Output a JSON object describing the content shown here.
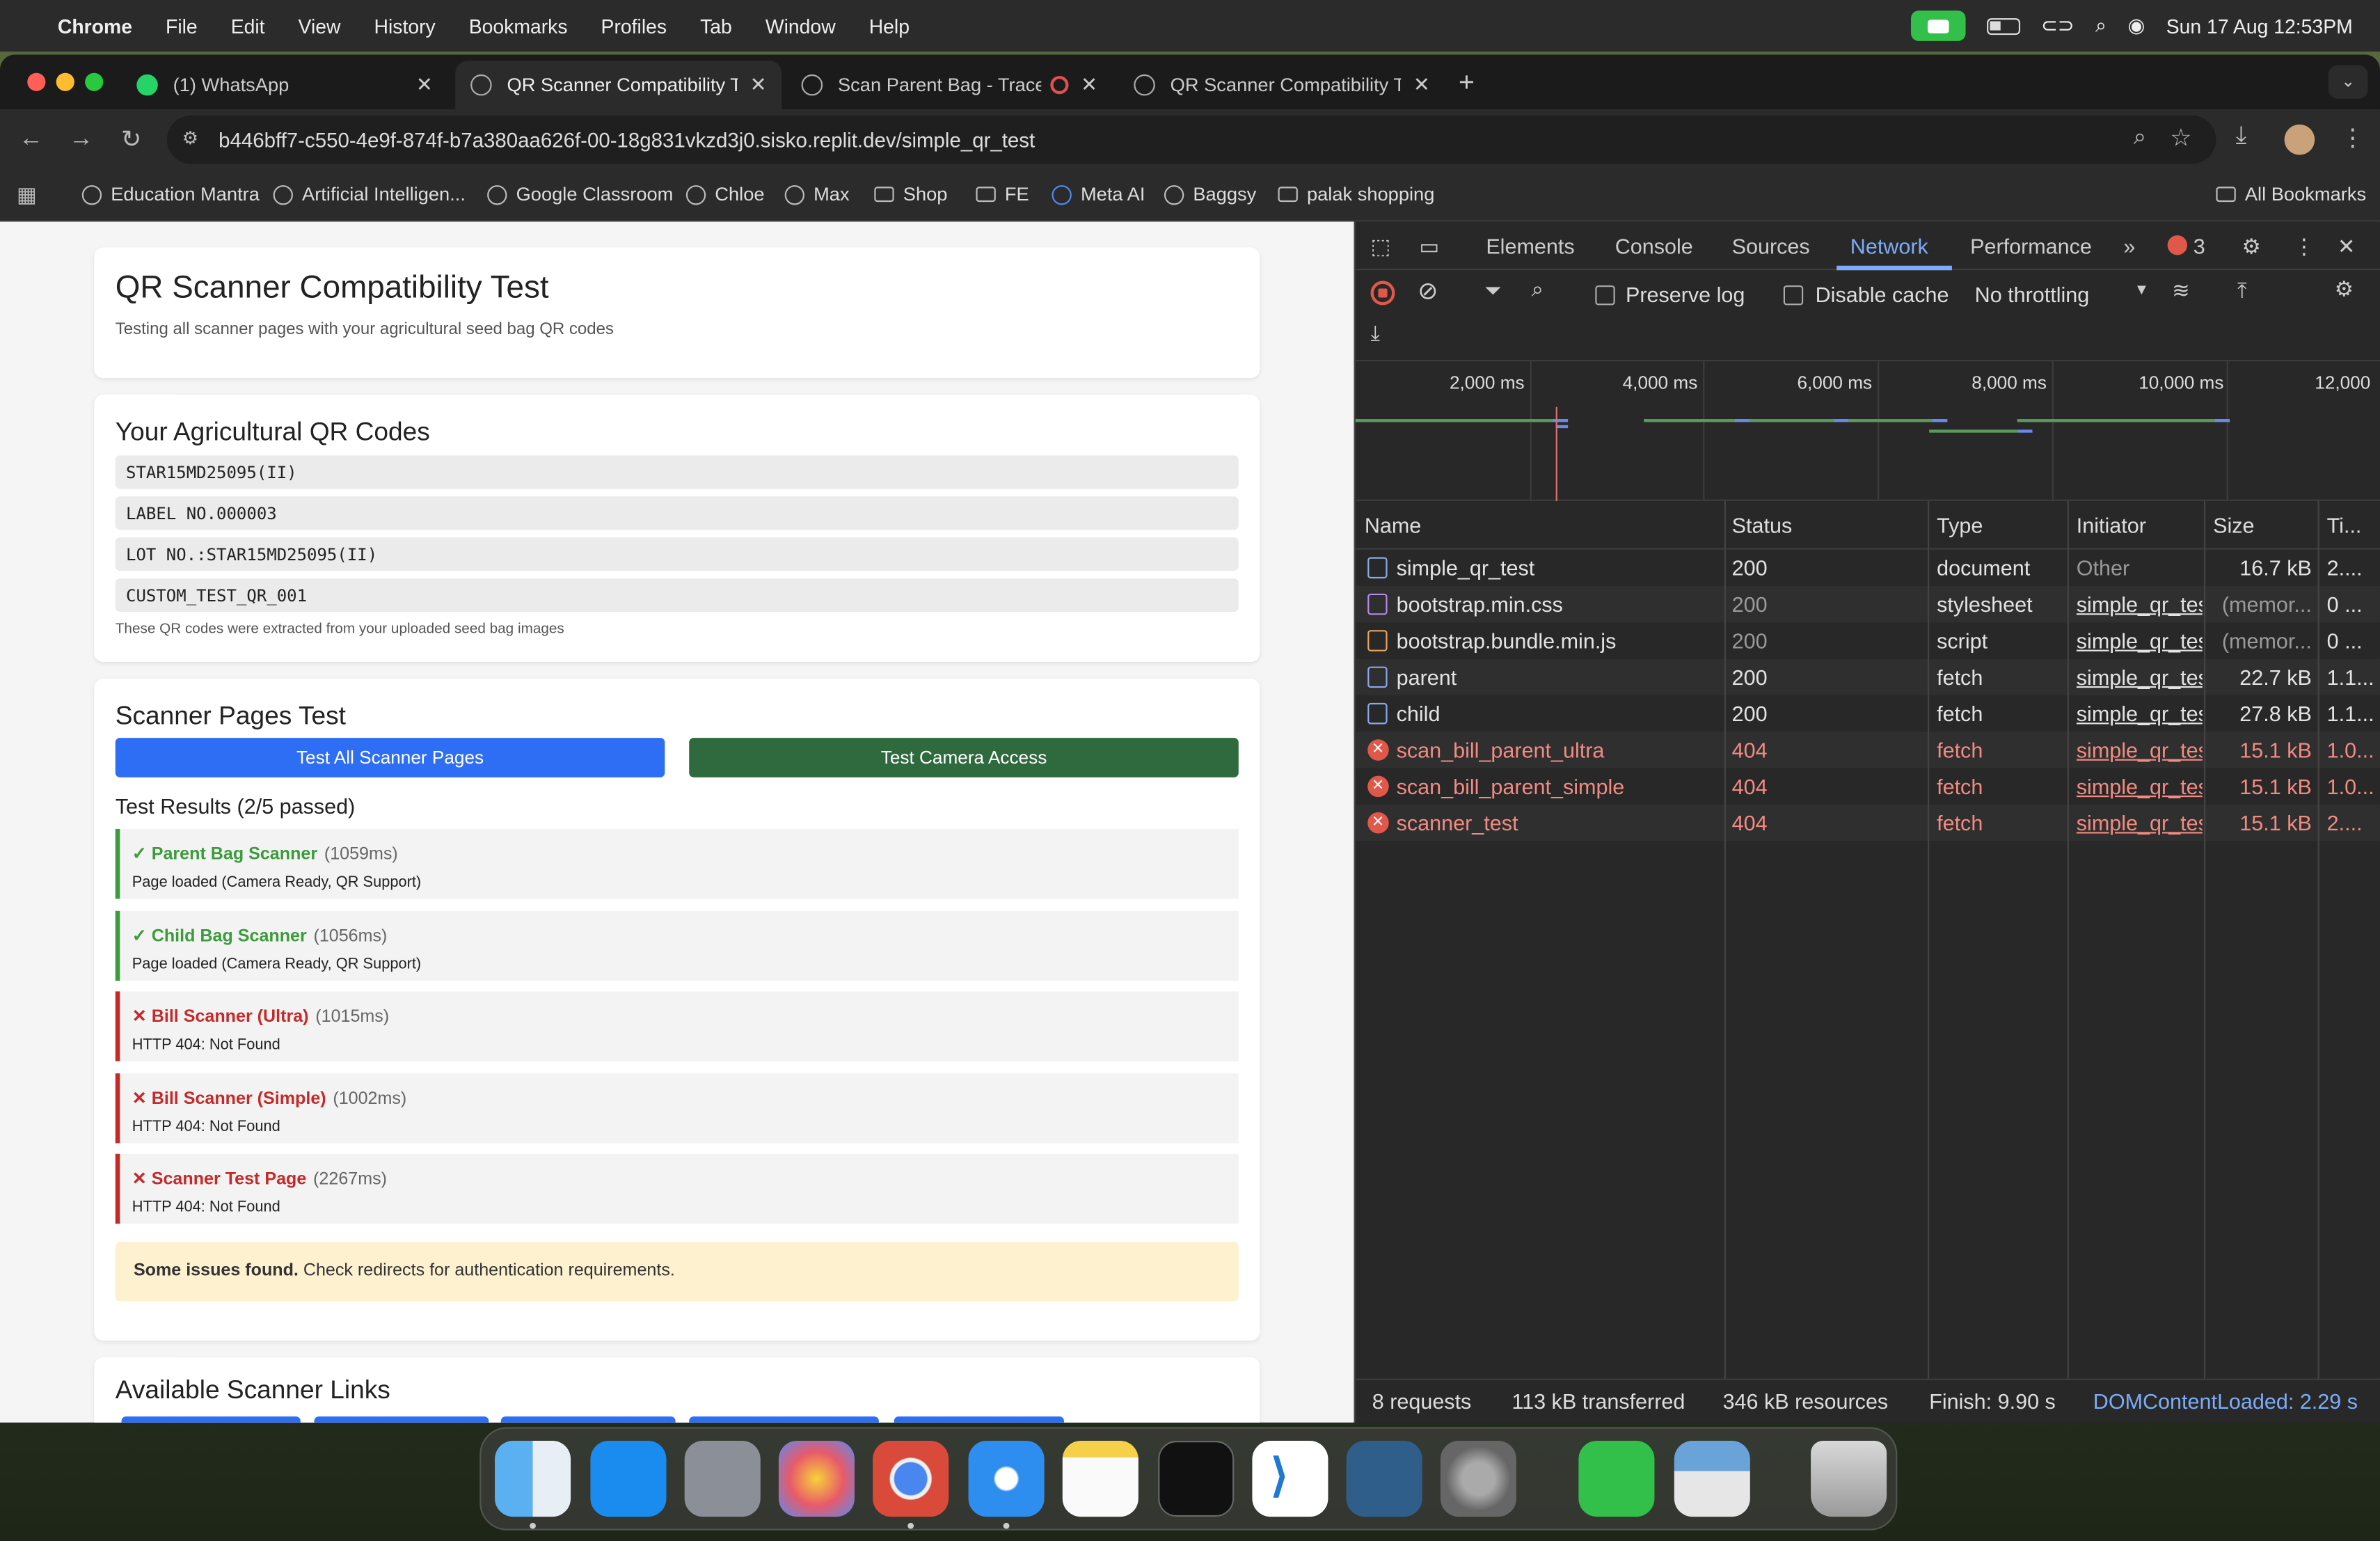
{
  "menubar": {
    "app": "Chrome",
    "menus": [
      "File",
      "Edit",
      "View",
      "History",
      "Bookmarks",
      "Profiles",
      "Tab",
      "Window",
      "Help"
    ],
    "datetime": "Sun 17 Aug  12:53PM"
  },
  "tabs": [
    {
      "title": "(1) WhatsApp"
    },
    {
      "title": "QR Scanner Compatibility Test"
    },
    {
      "title": "Scan Parent Bag - TraceTrack"
    },
    {
      "title": "QR Scanner Compatibility Test"
    }
  ],
  "url": "b446bff7-c550-4e9f-874f-b7a380aa626f-00-18g831vkzd3j0.sisko.replit.dev/simple_qr_test",
  "bookmarks": [
    {
      "label": "Education Mantra",
      "kind": "site"
    },
    {
      "label": "Artificial Intelligen...",
      "kind": "site"
    },
    {
      "label": "Google Classroom",
      "kind": "site"
    },
    {
      "label": "Chloe",
      "kind": "site"
    },
    {
      "label": "Max",
      "kind": "site"
    },
    {
      "label": "Shop",
      "kind": "folder"
    },
    {
      "label": "FE",
      "kind": "folder"
    },
    {
      "label": "Meta AI",
      "kind": "site"
    },
    {
      "label": "Baggsy",
      "kind": "site"
    },
    {
      "label": "palak shopping",
      "kind": "folder"
    }
  ],
  "all_bookmarks": "All Bookmarks",
  "page": {
    "title": "QR Scanner Compatibility Test",
    "subtitle": "Testing all scanner pages with your agricultural seed bag QR codes",
    "codes_heading": "Your Agricultural QR Codes",
    "codes": [
      "STAR15MD25095(II)",
      "LABEL NO.000003",
      "LOT NO.:STAR15MD25095(II)",
      "CUSTOM_TEST_QR_001"
    ],
    "codes_note": "These QR codes were extracted from your uploaded seed bag images",
    "scanner_heading": "Scanner Pages Test",
    "btn_all": "Test All Scanner Pages",
    "btn_camera": "Test Camera Access",
    "results_heading": "Test Results (2/5 passed)",
    "results": [
      {
        "name": "✓ Parent Bag Scanner",
        "time": "(1059ms)",
        "detail": "Page loaded (Camera Ready, QR Support)",
        "ok": true
      },
      {
        "name": "✓ Child Bag Scanner",
        "time": "(1056ms)",
        "detail": "Page loaded (Camera Ready, QR Support)",
        "ok": true
      },
      {
        "name": "✕ Bill Scanner (Ultra)",
        "time": "(1015ms)",
        "detail": "HTTP 404: Not Found",
        "ok": false
      },
      {
        "name": "✕ Bill Scanner (Simple)",
        "time": "(1002ms)",
        "detail": "HTTP 404: Not Found",
        "ok": false
      },
      {
        "name": "✕ Scanner Test Page",
        "time": "(2267ms)",
        "detail": "HTTP 404: Not Found",
        "ok": false
      }
    ],
    "warn_bold": "Some issues found.",
    "warn_text": " Check redirects for authentication requirements.",
    "links_heading": "Available Scanner Links"
  },
  "devtools": {
    "tabs": [
      "Elements",
      "Console",
      "Sources",
      "Network",
      "Performance"
    ],
    "active_tab": "Network",
    "error_count": "3",
    "preserve_log": "Preserve log",
    "disable_cache": "Disable cache",
    "throttling": "No throttling",
    "timeline_ticks": [
      "2,000 ms",
      "4,000 ms",
      "6,000 ms",
      "8,000 ms",
      "10,000 ms",
      "12,000"
    ],
    "columns": [
      "Name",
      "Status",
      "Type",
      "Initiator",
      "Size",
      "Ti..."
    ],
    "requests": [
      {
        "name": "simple_qr_test",
        "status": "200",
        "type": "document",
        "initiator": "Other",
        "size": "16.7 kB",
        "time": "2....",
        "icon": "doc-icon"
      },
      {
        "name": "bootstrap.min.css",
        "status": "200",
        "type": "stylesheet",
        "initiator": "simple_qr_test",
        "size": "(memor...",
        "time": "0 ...",
        "icon": "css-icon"
      },
      {
        "name": "bootstrap.bundle.min.js",
        "status": "200",
        "type": "script",
        "initiator": "simple_qr_test",
        "size": "(memor...",
        "time": "0 ...",
        "icon": "js-icon"
      },
      {
        "name": "parent",
        "status": "200",
        "type": "fetch",
        "initiator": "simple_qr_test",
        "size": "22.7 kB",
        "time": "1.1...",
        "icon": "doc-icon"
      },
      {
        "name": "child",
        "status": "200",
        "type": "fetch",
        "initiator": "simple_qr_test",
        "size": "27.8 kB",
        "time": "1.1...",
        "icon": "doc-icon"
      },
      {
        "name": "scan_bill_parent_ultra",
        "status": "404",
        "type": "fetch",
        "initiator": "simple_qr_test",
        "size": "15.1 kB",
        "time": "1.0...",
        "icon": "error-icon"
      },
      {
        "name": "scan_bill_parent_simple",
        "status": "404",
        "type": "fetch",
        "initiator": "simple_qr_test",
        "size": "15.1 kB",
        "time": "1.0...",
        "icon": "error-icon"
      },
      {
        "name": "scanner_test",
        "status": "404",
        "type": "fetch",
        "initiator": "simple_qr_test",
        "size": "15.1 kB",
        "time": "2....",
        "icon": "error-icon"
      }
    ],
    "footer": {
      "requests": "8 requests",
      "transferred": "113 kB transferred",
      "resources": "346 kB resources",
      "finish": "Finish: 9.90 s",
      "dcl": "DOMContentLoaded: 2.29 s"
    }
  },
  "colors": {
    "primary_button": "#2e6ef5",
    "camera_button": "#2f6a3e",
    "success": "#3c9b3c",
    "error": "#c42a2a",
    "devtools_accent": "#7cacf8",
    "error_text": "#f28b82"
  }
}
